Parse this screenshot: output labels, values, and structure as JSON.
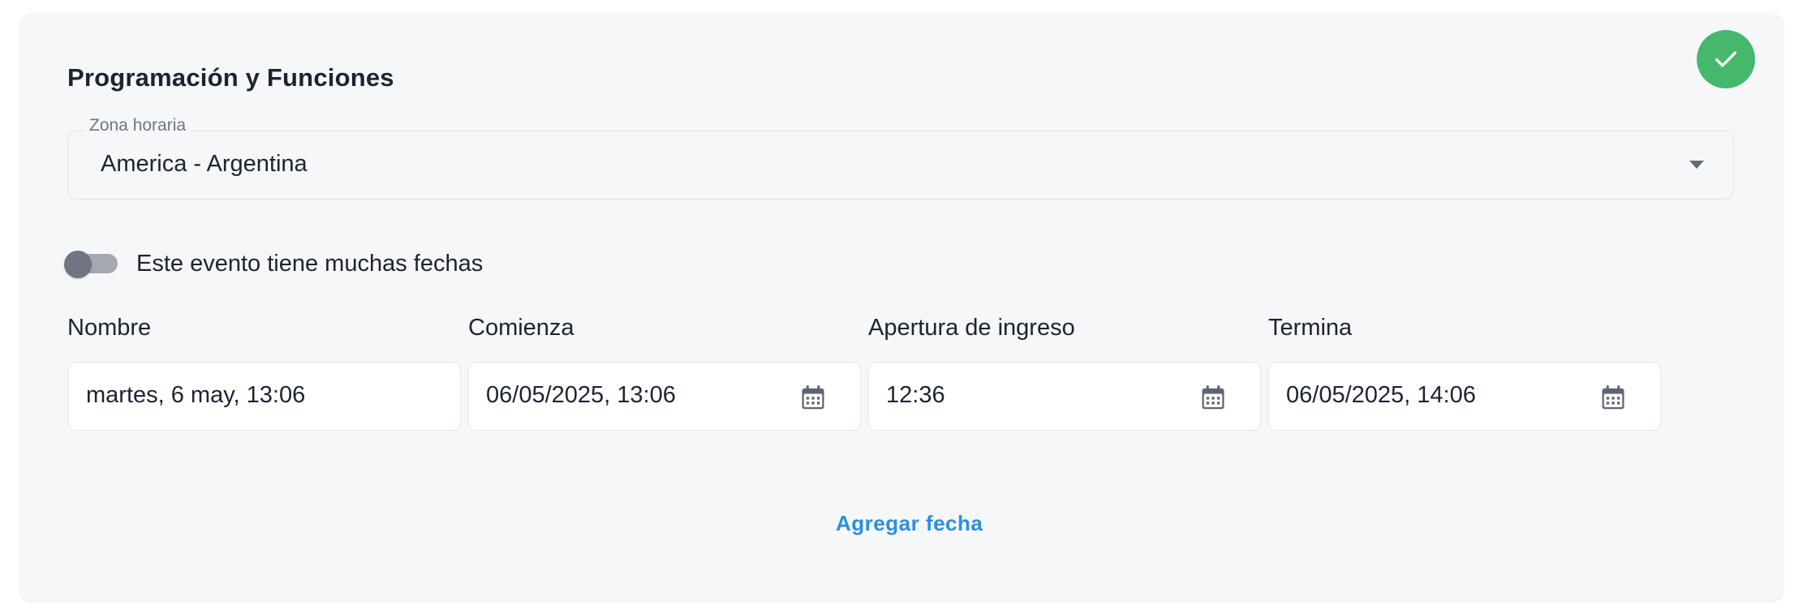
{
  "section": {
    "title": "Programación y Funciones",
    "status_icon": "check-icon",
    "status_color": "#45b86b"
  },
  "timezone": {
    "label": "Zona horaria",
    "value": "America - Argentina",
    "icon": "caret-down-icon"
  },
  "multi_dates_toggle": {
    "label": "Este evento tiene muchas fechas",
    "checked": false
  },
  "columns": {
    "name": "Nombre",
    "start": "Comienza",
    "doors": "Apertura de ingreso",
    "end": "Termina"
  },
  "row": {
    "name": "martes, 6 may, 13:06",
    "start": "06/05/2025, 13:06",
    "doors": "12:36",
    "end": "06/05/2025, 14:06",
    "picker_icon": "calendar-icon"
  },
  "add_date_label": "Agregar fecha",
  "accent_color": "#2b8ee0"
}
